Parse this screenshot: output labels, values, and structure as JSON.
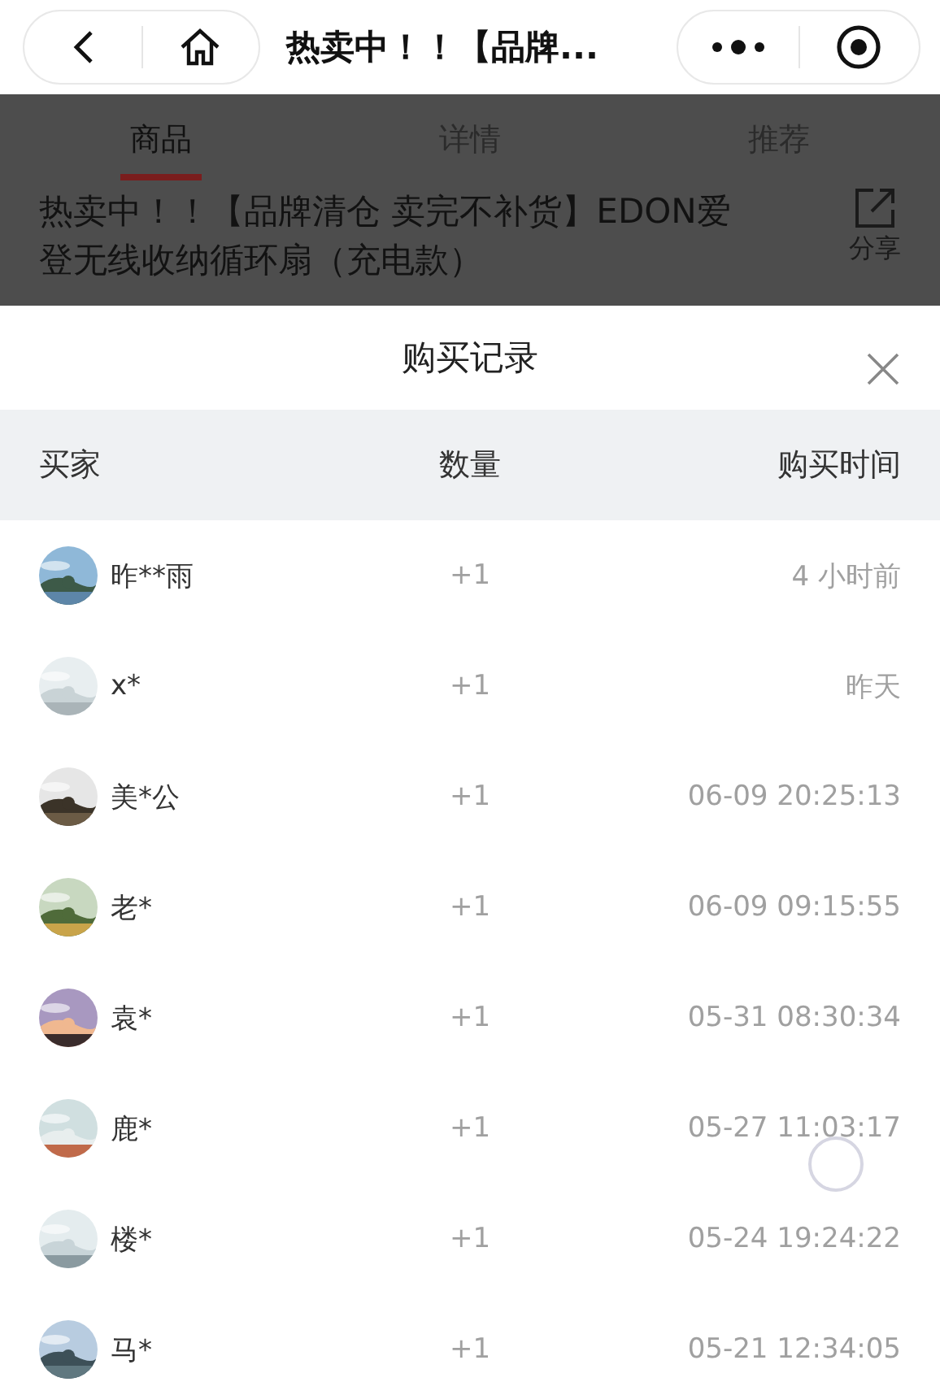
{
  "nav_bar": {
    "title": "热卖中！！【品牌..."
  },
  "tabs": [
    {
      "label": "商品",
      "selected": true
    },
    {
      "label": "详情",
      "selected": false
    },
    {
      "label": "推荐",
      "selected": false
    }
  ],
  "product": {
    "title": "热卖中！！【品牌清仓 卖完不补货】EDON爱登无线收纳循环扇（充电款）",
    "share_label": "分享"
  },
  "sheet": {
    "title": "购买记录",
    "columns": [
      "买家",
      "数量",
      "购买时间"
    ],
    "rows": [
      {
        "buyer": "昨**雨",
        "quantity": "+1",
        "time": "4 小时前"
      },
      {
        "buyer": "x*",
        "quantity": "+1",
        "time": "昨天"
      },
      {
        "buyer": "美*公",
        "quantity": "+1",
        "time": "06-09 20:25:13"
      },
      {
        "buyer": "老*",
        "quantity": "+1",
        "time": "06-09 09:15:55"
      },
      {
        "buyer": "袁*",
        "quantity": "+1",
        "time": "05-31 08:30:34"
      },
      {
        "buyer": "鹿*",
        "quantity": "+1",
        "time": "05-27 11:03:17"
      },
      {
        "buyer": "楼*",
        "quantity": "+1",
        "time": "05-24 19:24:22"
      },
      {
        "buyer": "马*",
        "quantity": "+1",
        "time": "05-21 12:34:05"
      }
    ]
  }
}
